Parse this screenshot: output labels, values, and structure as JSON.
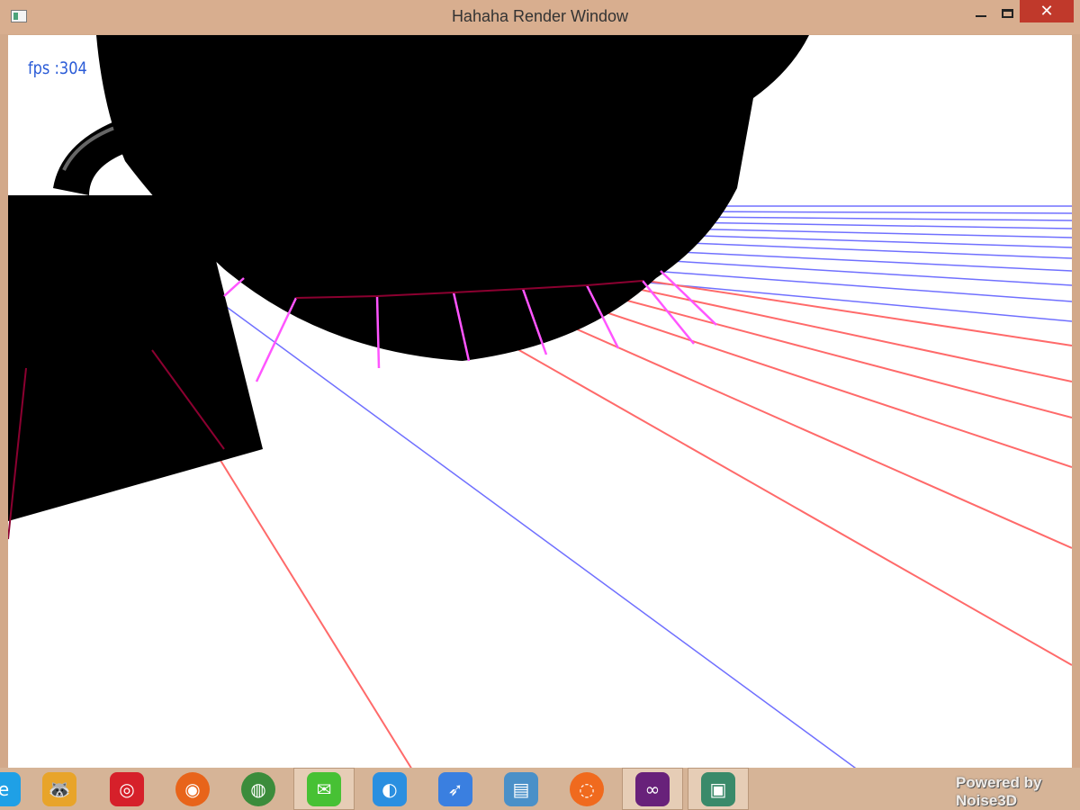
{
  "window": {
    "title": "Hahaha Render Window",
    "close_glyph": "✕"
  },
  "overlay": {
    "fps_text": "fps :304"
  },
  "scene": {
    "background": "#ffffff",
    "object_color": "#000000",
    "line_colors": {
      "red": "#ff6a6a",
      "blue": "#7070ff",
      "magenta": "#ff55ff",
      "dark_red": "#8b0030",
      "purple": "#7a1a9a"
    }
  },
  "taskbar": {
    "items": [
      {
        "icon": "browser-icon",
        "glyph": "e",
        "color": "#1fa0e6"
      },
      {
        "icon": "yy-raccoon-icon",
        "glyph": "🦝",
        "color": "#e8a42a"
      },
      {
        "icon": "netease-music-icon",
        "glyph": "◎",
        "color": "#d6202a"
      },
      {
        "icon": "firefox-icon",
        "glyph": "◉",
        "color": "#e8641a"
      },
      {
        "icon": "chrome-icon",
        "glyph": "◍",
        "color": "#3b8c3b"
      },
      {
        "icon": "wechat-icon",
        "glyph": "✉",
        "color": "#47c134"
      },
      {
        "icon": "qq-browser-icon",
        "glyph": "◐",
        "color": "#2a8fe0"
      },
      {
        "icon": "feige-bird-icon",
        "glyph": "➶",
        "color": "#3a7fe0"
      },
      {
        "icon": "control-panel-icon",
        "glyph": "▤",
        "color": "#4a90c8"
      },
      {
        "icon": "origin-icon",
        "glyph": "◌",
        "color": "#f06a1e"
      },
      {
        "icon": "visual-studio-icon",
        "glyph": "∞",
        "color": "#68217a"
      },
      {
        "icon": "render-window-icon",
        "glyph": "▣",
        "color": "#3a8a6a"
      }
    ],
    "powered_text": "Powered by Noise3D"
  }
}
